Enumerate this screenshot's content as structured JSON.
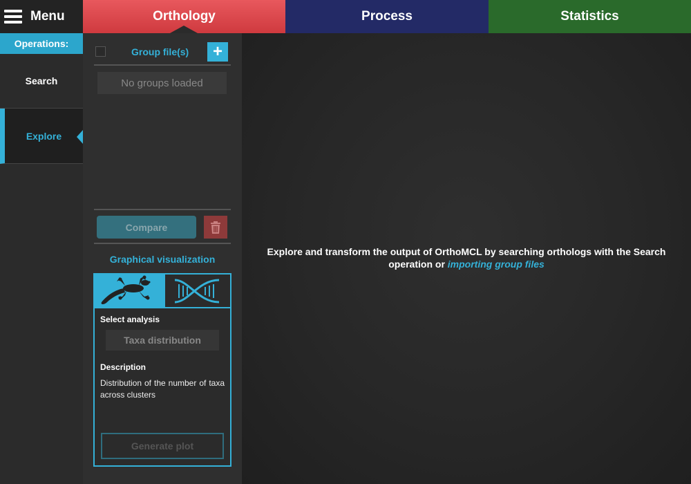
{
  "menu": {
    "label": "Menu",
    "icon": "hamburger-icon"
  },
  "tabs": [
    {
      "label": "Orthology",
      "color": "#e04a4f",
      "active": true
    },
    {
      "label": "Process",
      "color": "#232a66"
    },
    {
      "label": "Statistics",
      "color": "#2a6a2b"
    }
  ],
  "operations": {
    "header": "Operations:",
    "items": [
      {
        "label": "Search",
        "active": false
      },
      {
        "label": "Explore",
        "active": true
      }
    ]
  },
  "groups": {
    "title": "Group file(s)",
    "add_label": "+",
    "empty_text": "No groups loaded",
    "compare_label": "Compare"
  },
  "visualization": {
    "title": "Graphical visualization",
    "select_label": "Select analysis",
    "selected_analysis": "Taxa distribution",
    "description_label": "Description",
    "description_text": "Distribution of the number of taxa across clusters",
    "generate_label": "Generate plot"
  },
  "main": {
    "message": "Explore and transform the output of OrthoMCL by searching orthologs with the Search operation or",
    "link_text": "importing group files"
  },
  "colors": {
    "accent": "#34b1d8",
    "danger": "#8e3a3a"
  }
}
